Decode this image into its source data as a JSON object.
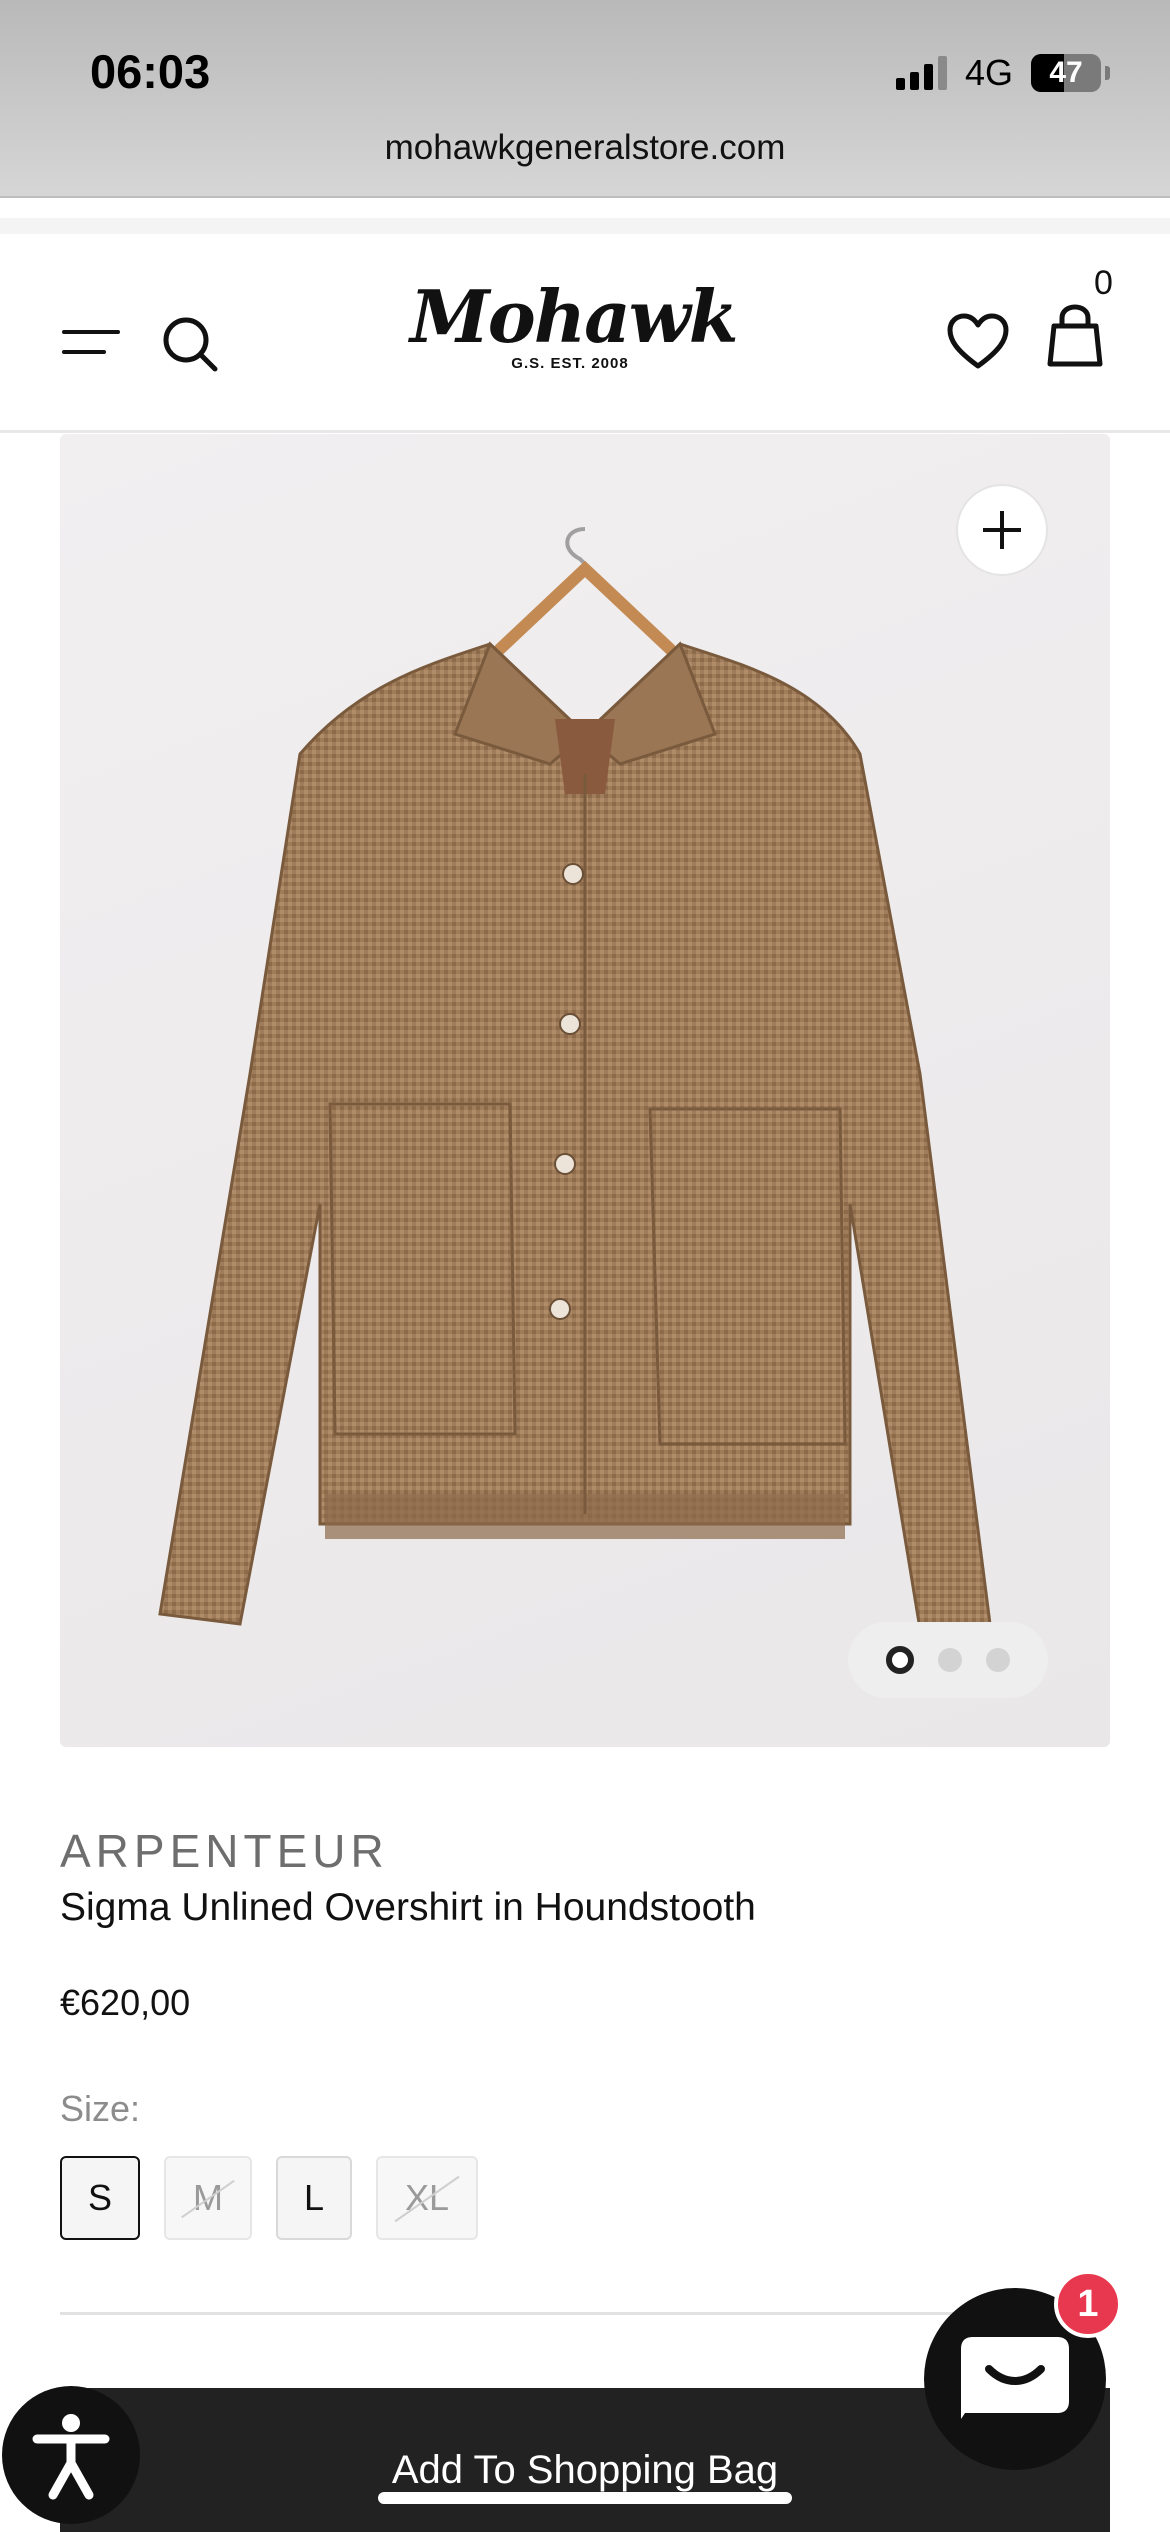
{
  "status_bar": {
    "time": "06:03",
    "network": "4G",
    "battery": "47",
    "battery_level": 0.47
  },
  "browser": {
    "url": "mohawkgeneralstore.com"
  },
  "header": {
    "logo_script": "Mohawk",
    "logo_sub": "G.S. EST. 2008",
    "cart_count": "0"
  },
  "gallery": {
    "slide_count": 3,
    "active_index": 0
  },
  "product": {
    "brand": "ARPENTEUR",
    "title": "Sigma Unlined Overshirt in Houndstooth",
    "price": "€620,00",
    "size_label": "Size:",
    "sizes": [
      {
        "label": "S",
        "available": true,
        "selected": true
      },
      {
        "label": "M",
        "available": false
      },
      {
        "label": "L",
        "available": true
      },
      {
        "label": "XL",
        "available": false
      }
    ]
  },
  "actions": {
    "add_to_bag": "Add To Shopping Bag"
  },
  "chat": {
    "badge": "1"
  },
  "colors": {
    "accent": "#222222",
    "badge": "#e8384f",
    "shirt": "#a07d5a"
  },
  "icons": [
    "menu-icon",
    "search-icon",
    "heart-icon",
    "bag-icon",
    "plus-icon",
    "accessibility-icon",
    "chat-icon"
  ]
}
